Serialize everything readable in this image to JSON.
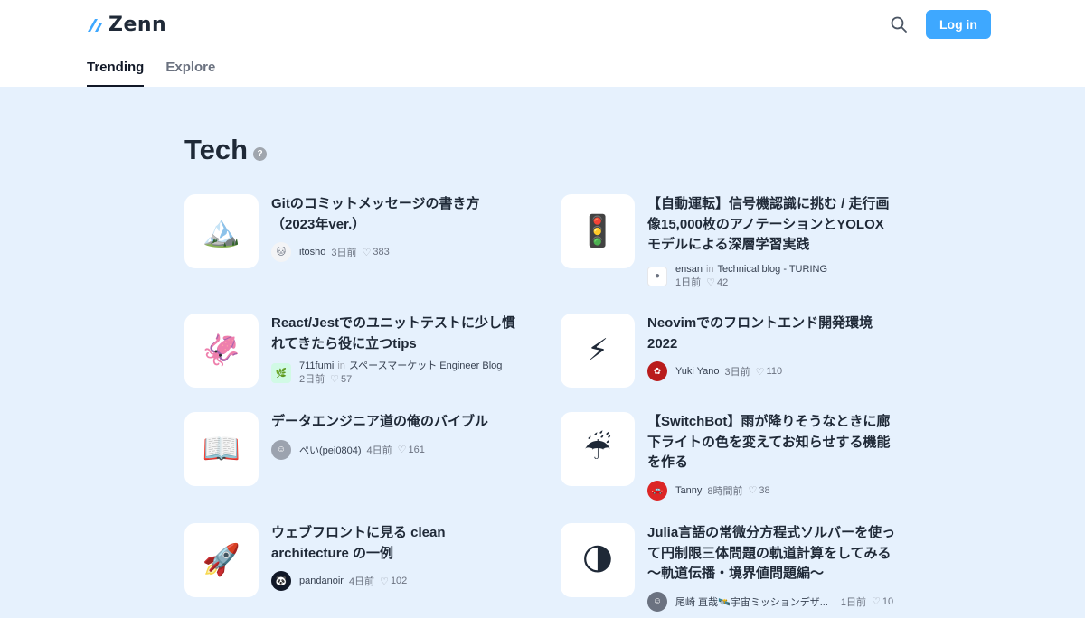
{
  "header": {
    "logo_text": "Zenn",
    "login_label": "Log in",
    "tabs": [
      {
        "label": "Trending"
      },
      {
        "label": "Explore"
      }
    ]
  },
  "section": {
    "title": "Tech",
    "help": "?"
  },
  "articles": [
    {
      "emoji": "🏔️",
      "title_lines": [
        "Gitのコミットメッセージの書き方",
        "（2023年ver.）"
      ],
      "author": "itosho",
      "date": "3日前",
      "likes": "383"
    },
    {
      "emoji": "🚦",
      "title_lines": [
        "【自動運転】信号機認識に挑む / 走行画",
        "像15,000枚のアノテーションとYOLOX",
        "モデルによる深層学習実践"
      ],
      "author": "ensan",
      "in": "in",
      "publication": "Technical blog - TURING",
      "date": "1日前",
      "likes": "42"
    },
    {
      "emoji": "🦑",
      "title_lines": [
        "React/Jestでのユニットテストに少し慣",
        "れてきたら役に立つtips"
      ],
      "author": "711fumi",
      "in": "in",
      "publication": "スペースマーケット Engineer Blog",
      "date": "2日前",
      "likes": "57"
    },
    {
      "emoji": "⚡",
      "title_lines": [
        "Neovimでのフロントエンド開発環境",
        "2022"
      ],
      "author": "Yuki Yano",
      "date": "3日前",
      "likes": "110"
    },
    {
      "emoji": "📖",
      "title_lines": [
        "データエンジニア道の俺のバイブル"
      ],
      "author": "ぺい(pei0804)",
      "date": "4日前",
      "likes": "161"
    },
    {
      "emoji": "☔",
      "title_lines": [
        "【SwitchBot】雨が降りそうなときに廊",
        "下ライトの色を変えてお知らせする機能",
        "を作る"
      ],
      "author": "Tanny",
      "date": "8時間前",
      "likes": "38"
    },
    {
      "emoji": "🚀",
      "title_lines": [
        "ウェブフロントに見る clean",
        "architecture の一例"
      ],
      "author": "pandanoir",
      "date": "4日前",
      "likes": "102"
    },
    {
      "emoji": "🌗",
      "title_lines": [
        "Julia言語の常微分方程式ソルバーを使っ",
        "て円制限三体問題の軌道計算をしてみる",
        "〜軌道伝播・境界値問題編〜"
      ],
      "author": "尾崎 直哉🛰️宇宙ミッションデザ...",
      "date": "1日前",
      "likes": "10"
    }
  ],
  "colors": {
    "accent": "#3ea8ff",
    "background_main": "#e6f1fd"
  },
  "icons": {
    "search": "search-icon",
    "heart": "heart-icon",
    "help": "help-icon"
  }
}
